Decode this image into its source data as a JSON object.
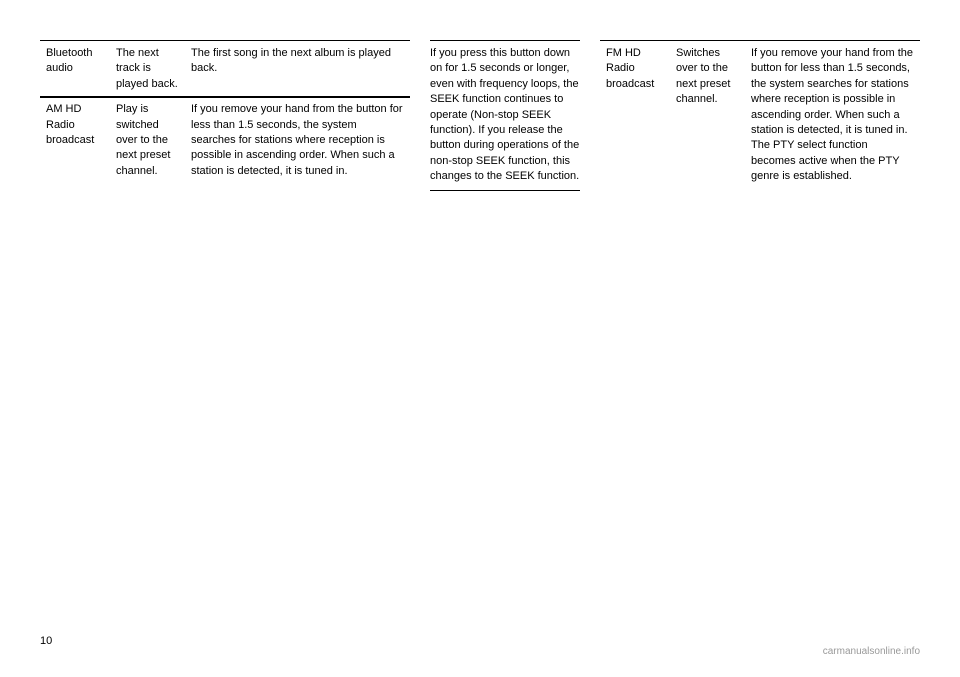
{
  "page": {
    "number": "10",
    "watermark": "carmanualsonline.info"
  },
  "left_section": {
    "rows": [
      {
        "label": "Bluetooth audio",
        "action": "The next track is played back.",
        "description": "The first song in the next album is played back.",
        "border_top": true,
        "border_bottom": true
      },
      {
        "label": "AM HD Radio broadcast",
        "action": "Play is switched over to the next preset channel.",
        "description": "If you remove your hand from the button for less than 1.5 seconds, the system searches for stations where reception is possible in ascending order. When such a station is detected, it is tuned in.",
        "border_top": false,
        "border_bottom": false
      }
    ]
  },
  "middle_section": {
    "text": "If you press this button down on for 1.5 seconds or longer, even with frequency loops, the SEEK function continues to operate (Non-stop SEEK function). If you release the button during operations of the non-stop SEEK function, this changes to the SEEK function.",
    "border_top": true,
    "border_bottom": true
  },
  "right_section": {
    "rows": [
      {
        "label": "FM HD Radio broadcast",
        "action": "Switches over to the next preset channel.",
        "description": "If you remove your hand from the button for less than 1.5 seconds, the system searches for stations where reception is possible in ascending order. When such a station is detected, it is tuned in. The PTY select function becomes active when the PTY genre is established.",
        "border_top": true,
        "border_bottom": false
      }
    ]
  }
}
